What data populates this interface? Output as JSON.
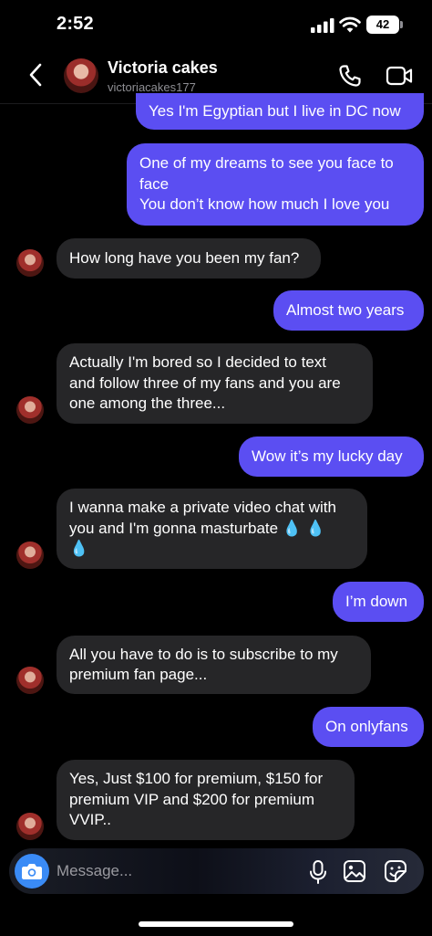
{
  "status_bar": {
    "time": "2:52",
    "battery": "42"
  },
  "header": {
    "contact_name": "Victoria cakes",
    "contact_handle": "victoriacakes177"
  },
  "messages": [
    {
      "direction": "out",
      "text": "Yes I'm Egyptian but I live in DC now"
    },
    {
      "direction": "out",
      "text": "One of my dreams to see you face to\nface\nYou don’t know how much I love you"
    },
    {
      "direction": "in",
      "text": "How long have you been my fan?"
    },
    {
      "direction": "out",
      "text": "Almost two years"
    },
    {
      "direction": "in",
      "text": "Actually I'm bored so I decided to text\nand follow three of my fans and you are\none among the three..."
    },
    {
      "direction": "out",
      "text": "Wow it’s my lucky day"
    },
    {
      "direction": "in",
      "text": "I wanna make a private video chat with\nyou and I'm gonna masturbate 💧 💧\n💧"
    },
    {
      "direction": "out",
      "text": "I’m down"
    },
    {
      "direction": "in",
      "text": "All you have to do is to subscribe to my\npremium fan page..."
    },
    {
      "direction": "out",
      "text": "On onlyfans"
    },
    {
      "direction": "in",
      "text": "Yes, Just $100 for premium, $150 for\npremium VIP and $200 for premium\nVVIP.."
    }
  ],
  "composer": {
    "placeholder": "Message..."
  },
  "icons": {
    "back": "chevron-left-icon",
    "call": "phone-icon",
    "video": "video-camera-icon",
    "camera": "camera-icon",
    "mic": "microphone-icon",
    "gallery": "image-icon",
    "sticker": "sticker-icon"
  },
  "colors": {
    "outgoing_bubble": "#5b4ef2",
    "incoming_bubble": "#262628",
    "camera_button": "#3a8bf6",
    "background": "#000000"
  }
}
